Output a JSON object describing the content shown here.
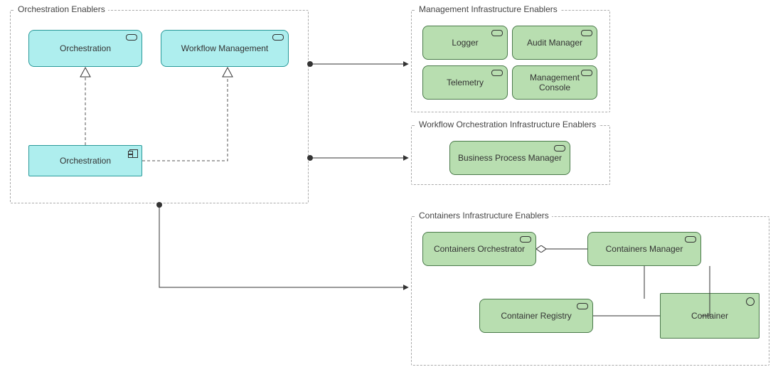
{
  "groups": {
    "orchestration": {
      "title": "Orchestration Enablers"
    },
    "mgmt": {
      "title": "Management Infrastructure Enablers"
    },
    "workflow": {
      "title": "Workflow Orchestration Infrastructure Enablers"
    },
    "containers": {
      "title": "Containers Infrastructure Enablers"
    }
  },
  "elements": {
    "orch1": {
      "label": "Orchestration"
    },
    "wfmgmt": {
      "label": "Workflow Management"
    },
    "orchcomp": {
      "label": "Orchestration"
    },
    "logger": {
      "label": "Logger"
    },
    "audit": {
      "label": "Audit Manager"
    },
    "telemetry": {
      "label": "Telemetry"
    },
    "mconsole": {
      "label": "Management Console"
    },
    "bpm": {
      "label": "Business Process Manager"
    },
    "corch": {
      "label": "Containers Orchestrator"
    },
    "cmgr": {
      "label": "Containers Manager"
    },
    "creg": {
      "label": "Container Registry"
    },
    "cont": {
      "label": "Container"
    }
  }
}
